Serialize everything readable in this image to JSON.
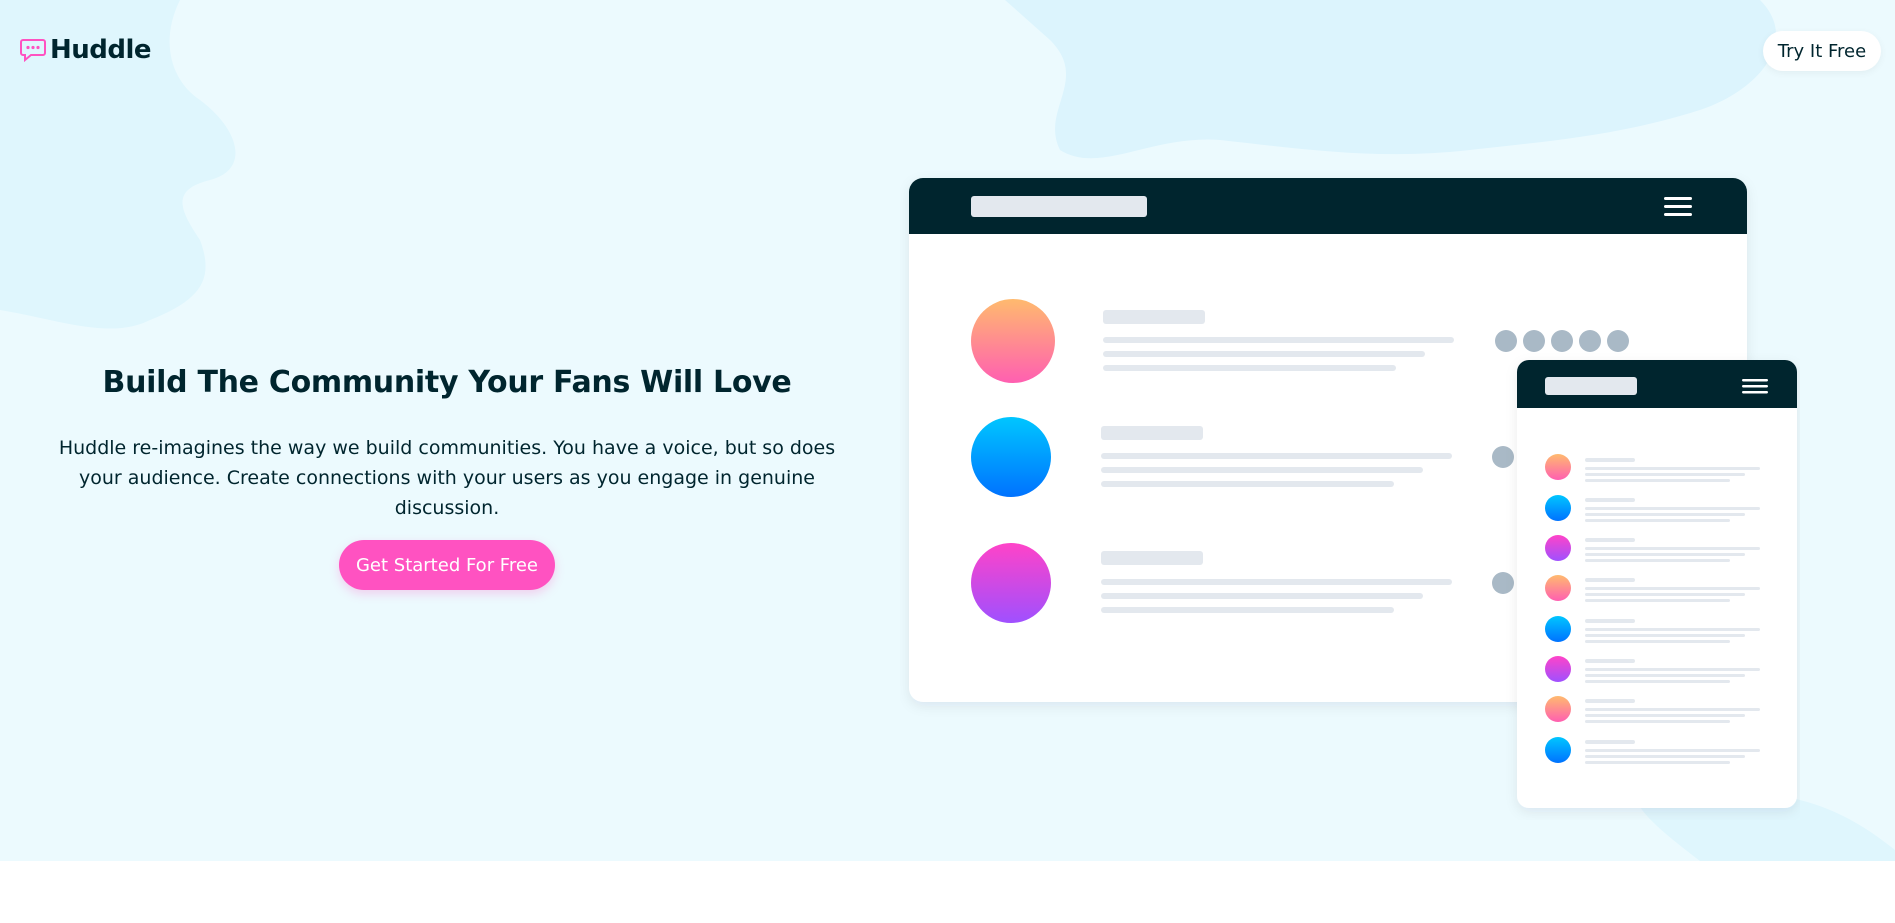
{
  "brand": {
    "name": "Huddle",
    "logo_icon": "chat-bubble-icon",
    "accent_color": "#ff52c1",
    "dark_color": "#00252e",
    "background_color": "#ecfafe"
  },
  "header": {
    "try_button_label": "Try It Free"
  },
  "hero": {
    "headline": "Build The Community Your Fans Will Love",
    "description": "Huddle re-imagines the way we build communities. You have a voice, but so does your audience. Create connections with your users as you engage in genuine discussion.",
    "cta_label": "Get Started For Free"
  },
  "illustration": {
    "desktop_icon": "hamburger-menu-icon",
    "mobile_icon": "hamburger-menu-icon"
  }
}
